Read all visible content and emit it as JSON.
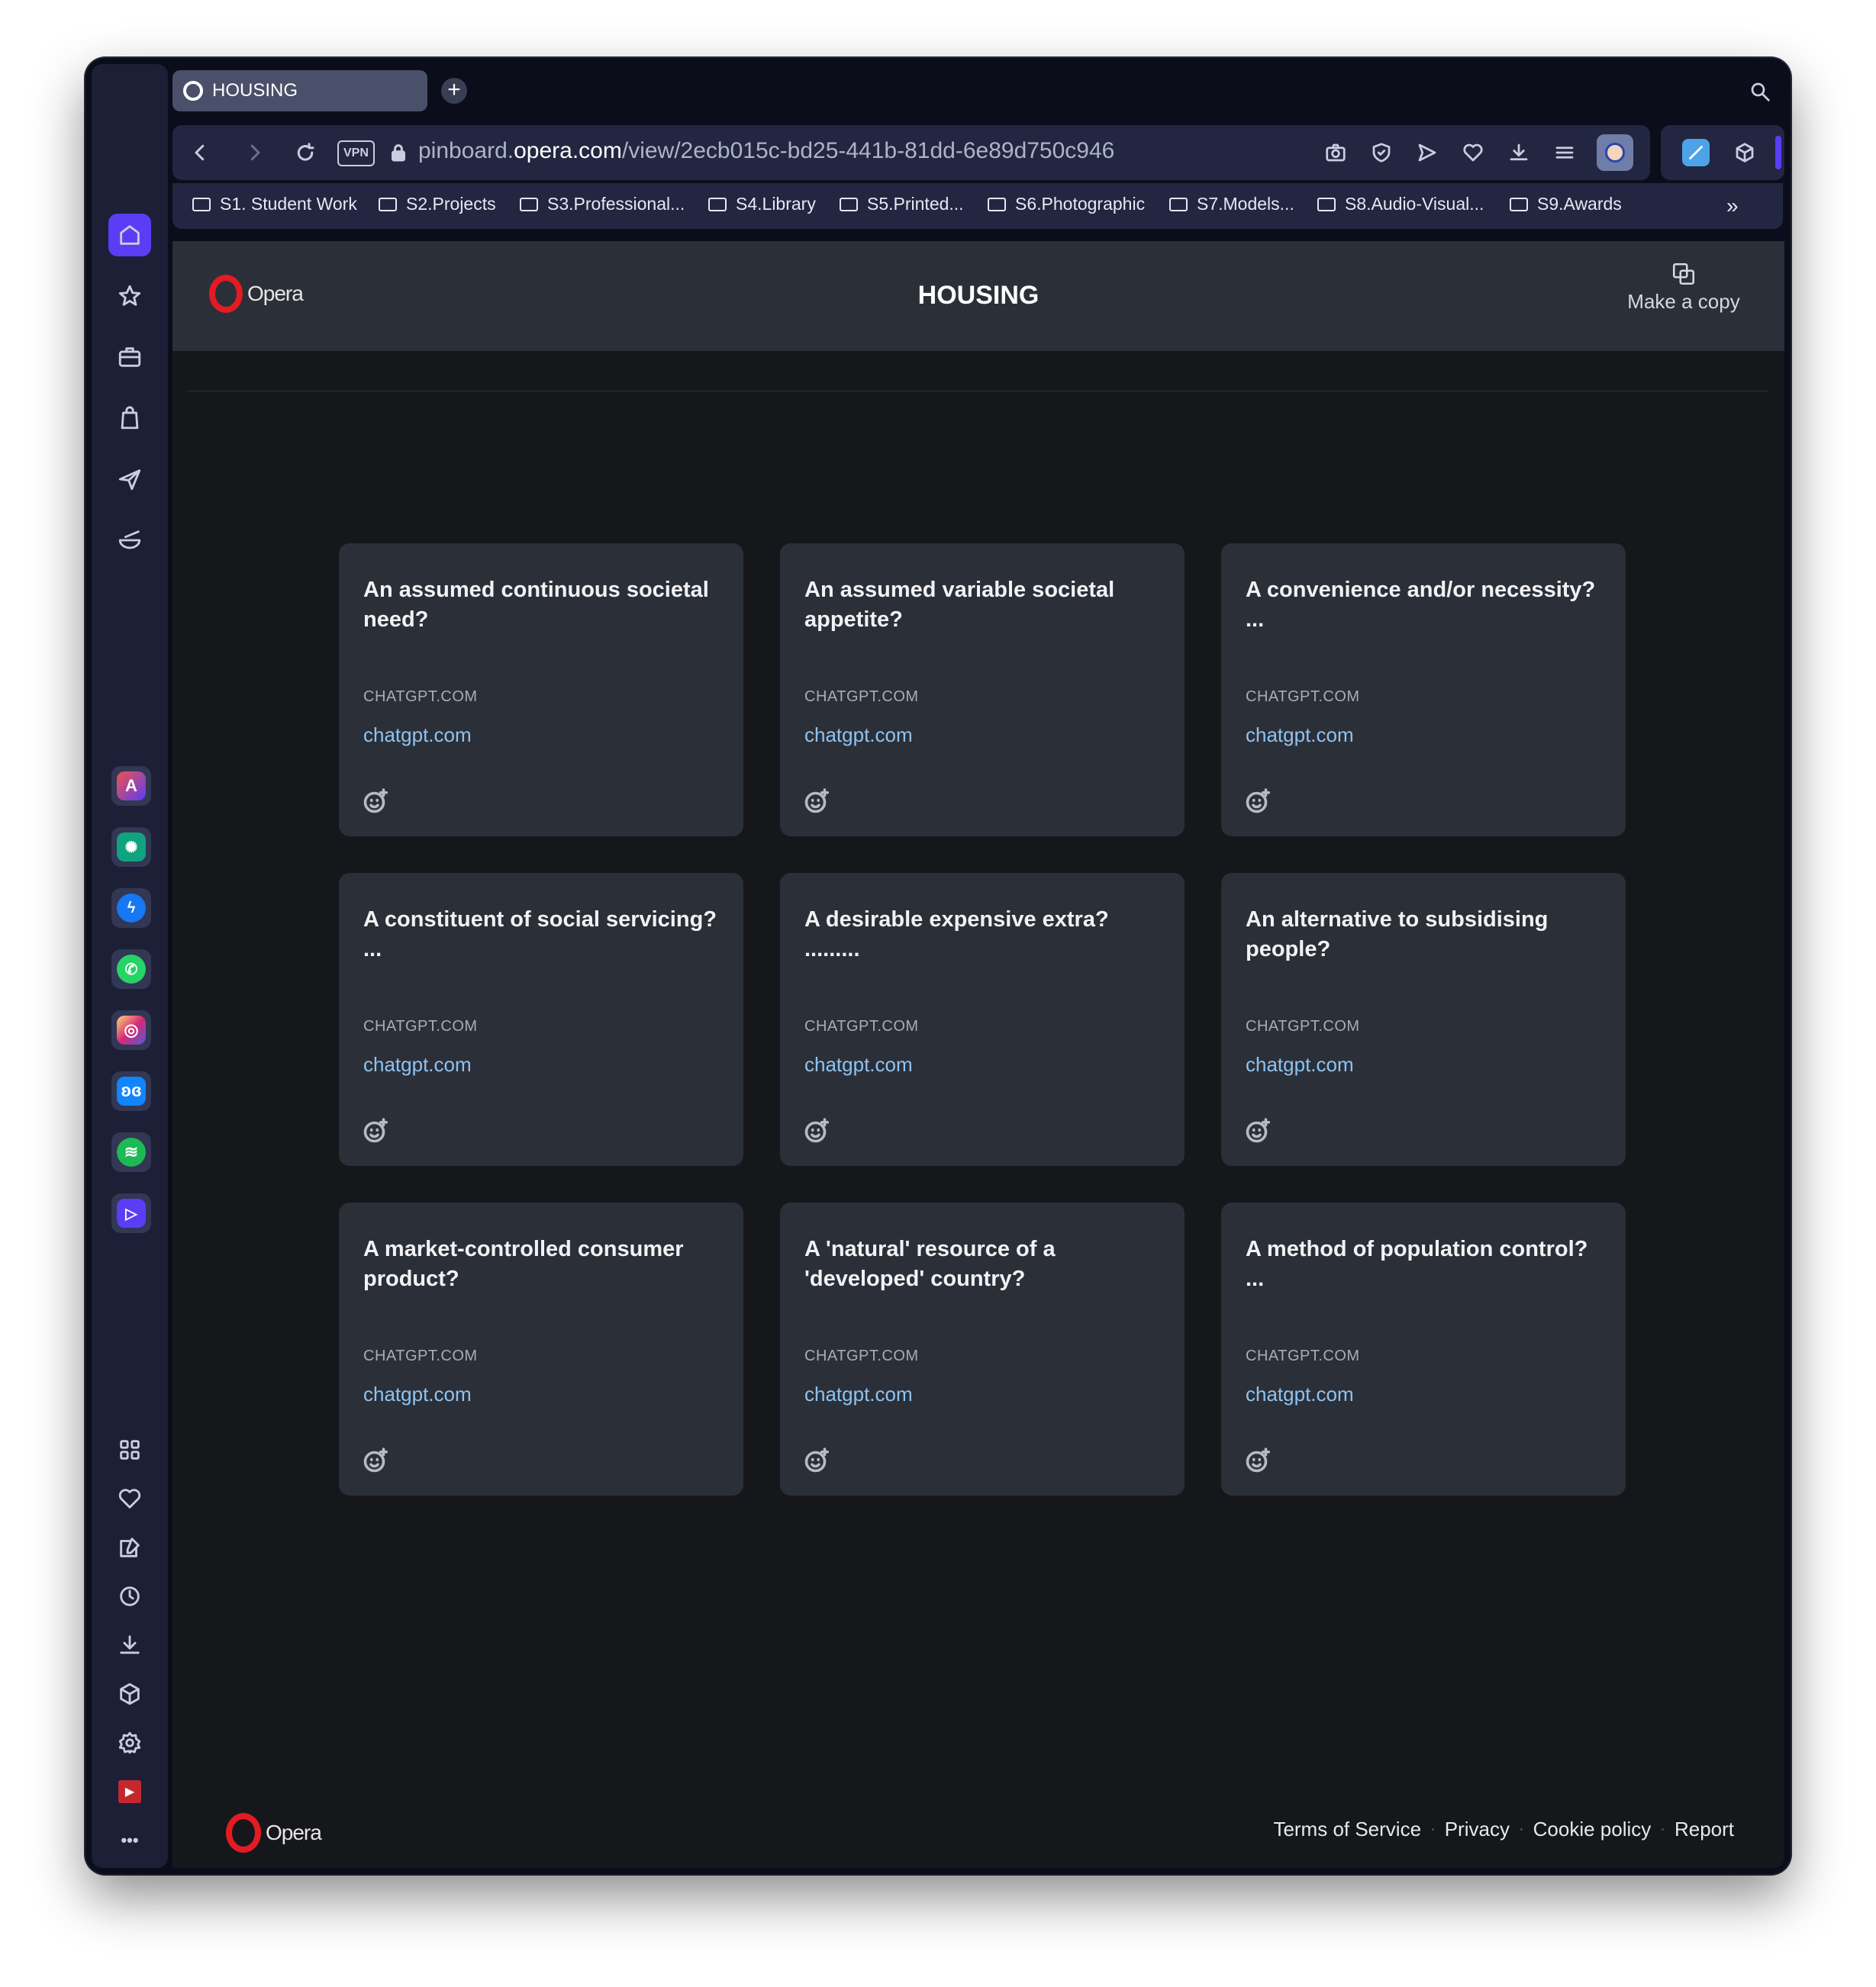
{
  "browser": {
    "tab_title": "HOUSING",
    "url_prefix": "pinboard.",
    "url_domain": "opera.com",
    "url_path": "/view/2ecb015c-bd25-441b-81dd-6e89d750c946",
    "vpn_label": "VPN",
    "new_tab_label": "+",
    "more_bookmarks_label": "»",
    "bookmarks": [
      "S1. Student Work",
      "S2.Projects",
      "S3.Professional...",
      "S4.Library",
      "S5.Printed...",
      "S6.Photographic",
      "S7.Models...",
      "S8.Audio-Visual...",
      "S9.Awards"
    ]
  },
  "sidebar": {
    "top_icons": [
      "home-icon",
      "star-icon",
      "briefcase-icon",
      "shopping-bag-icon",
      "airplane-icon",
      "bowl-icon"
    ],
    "apps": [
      "aria-app",
      "chatgpt-app",
      "messenger-app",
      "whatsapp-app",
      "instagram-app",
      "bluesky-app",
      "spotify-app",
      "player-app"
    ],
    "bottom_icons": [
      "grid-icon",
      "heart-icon",
      "pinboard-icon",
      "history-icon",
      "download-icon",
      "cube-icon",
      "settings-icon",
      "video-icon",
      "more-icon"
    ],
    "more_label": "•••"
  },
  "header": {
    "logo_text": "Opera",
    "title": "HOUSING",
    "copy_label": "Make a copy"
  },
  "cards": [
    {
      "title": "An assumed continuous societal need?",
      "domain": "CHATGPT.COM",
      "link": "chatgpt.com"
    },
    {
      "title": "An assumed variable societal appetite?",
      "domain": "CHATGPT.COM",
      "link": "chatgpt.com"
    },
    {
      "title": "A convenience and/or necessity?\n...",
      "domain": "CHATGPT.COM",
      "link": "chatgpt.com"
    },
    {
      "title": "A constituent of social servicing?\n...",
      "domain": "CHATGPT.COM",
      "link": "chatgpt.com"
    },
    {
      "title": "A desirable expensive extra?\n.........",
      "domain": "CHATGPT.COM",
      "link": "chatgpt.com"
    },
    {
      "title": "An alternative to subsidising people?",
      "domain": "CHATGPT.COM",
      "link": "chatgpt.com"
    },
    {
      "title": "A market-controlled consumer product?",
      "domain": "CHATGPT.COM",
      "link": "chatgpt.com"
    },
    {
      "title": "A 'natural' resource of a 'developed' country?",
      "domain": "CHATGPT.COM",
      "link": "chatgpt.com"
    },
    {
      "title": "A method of population control?\n...",
      "domain": "CHATGPT.COM",
      "link": "chatgpt.com"
    }
  ],
  "footer": {
    "logo_text": "Opera",
    "links": [
      "Terms of Service",
      "Privacy",
      "Cookie policy",
      "Report"
    ],
    "separator": "·"
  },
  "colors": {
    "accent": "#5b3df5",
    "link": "#8fc3f0",
    "opera_red": "#e31b23"
  }
}
